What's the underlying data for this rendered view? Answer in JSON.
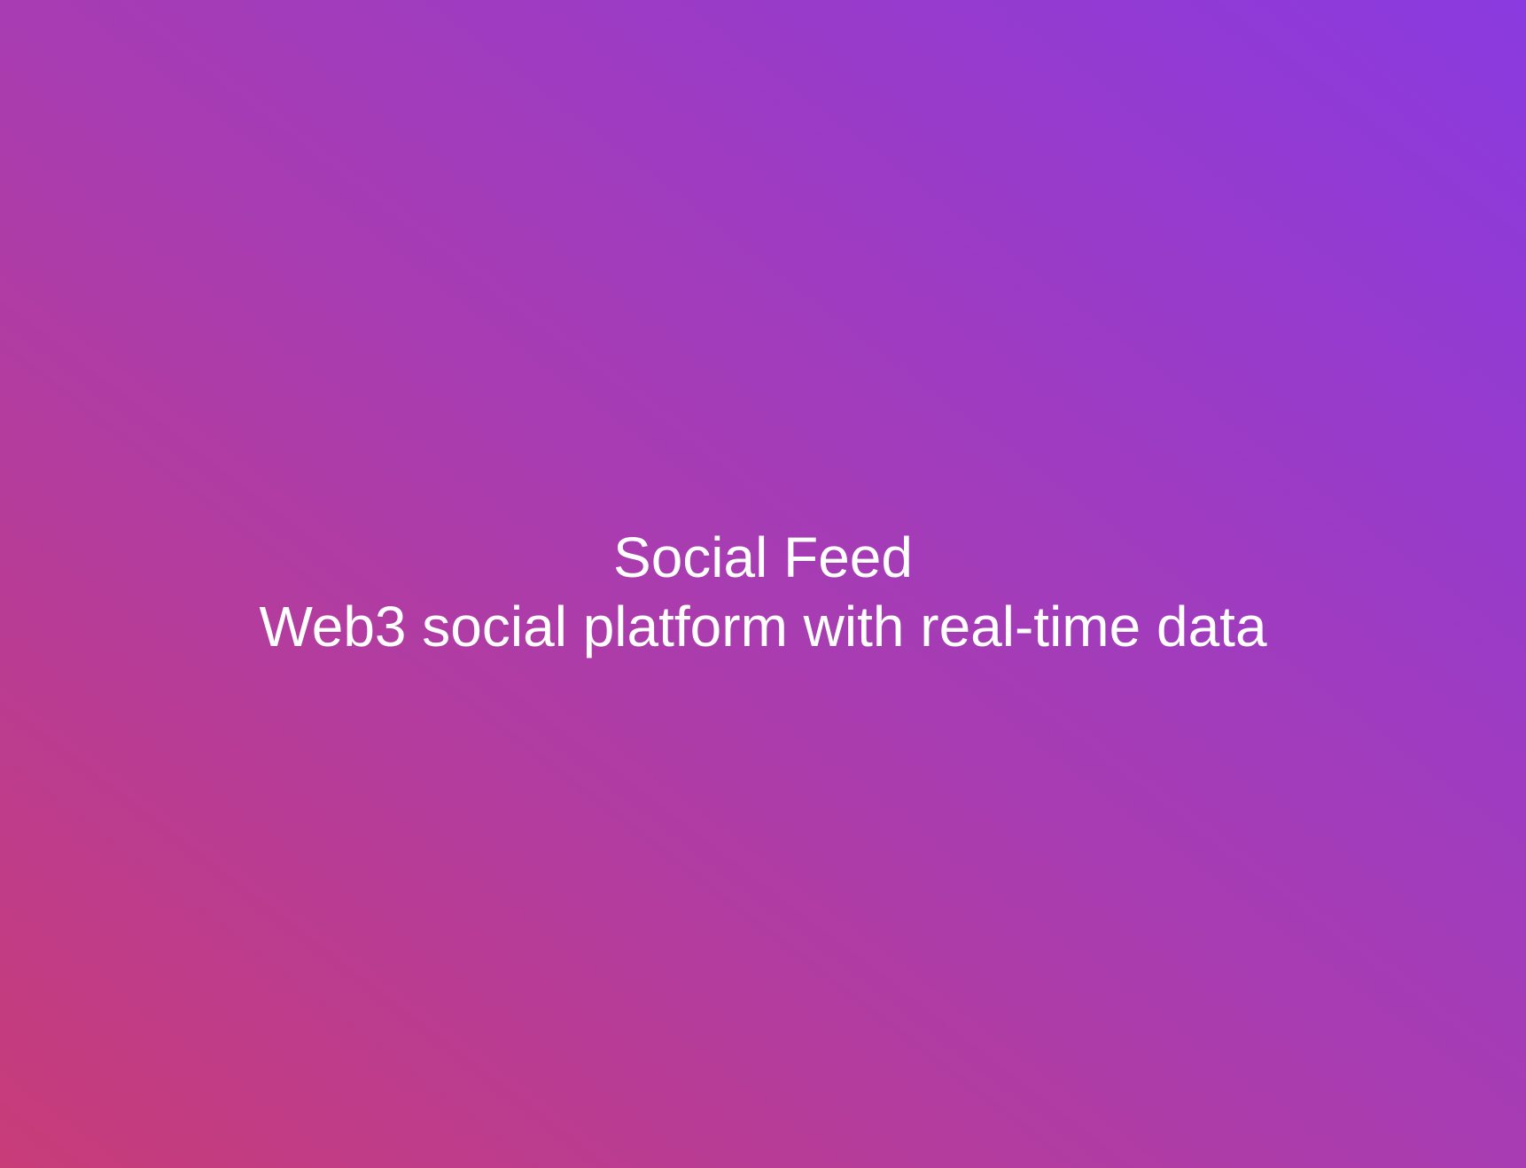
{
  "splash": {
    "title": "Social Feed",
    "subtitle": "Web3 social platform with real-time data",
    "gradient_colors": {
      "bottom_left": "#c83c78",
      "middle": "#a93cb0",
      "top_right": "#8a3ae0"
    },
    "text_color": "#ffffff"
  }
}
